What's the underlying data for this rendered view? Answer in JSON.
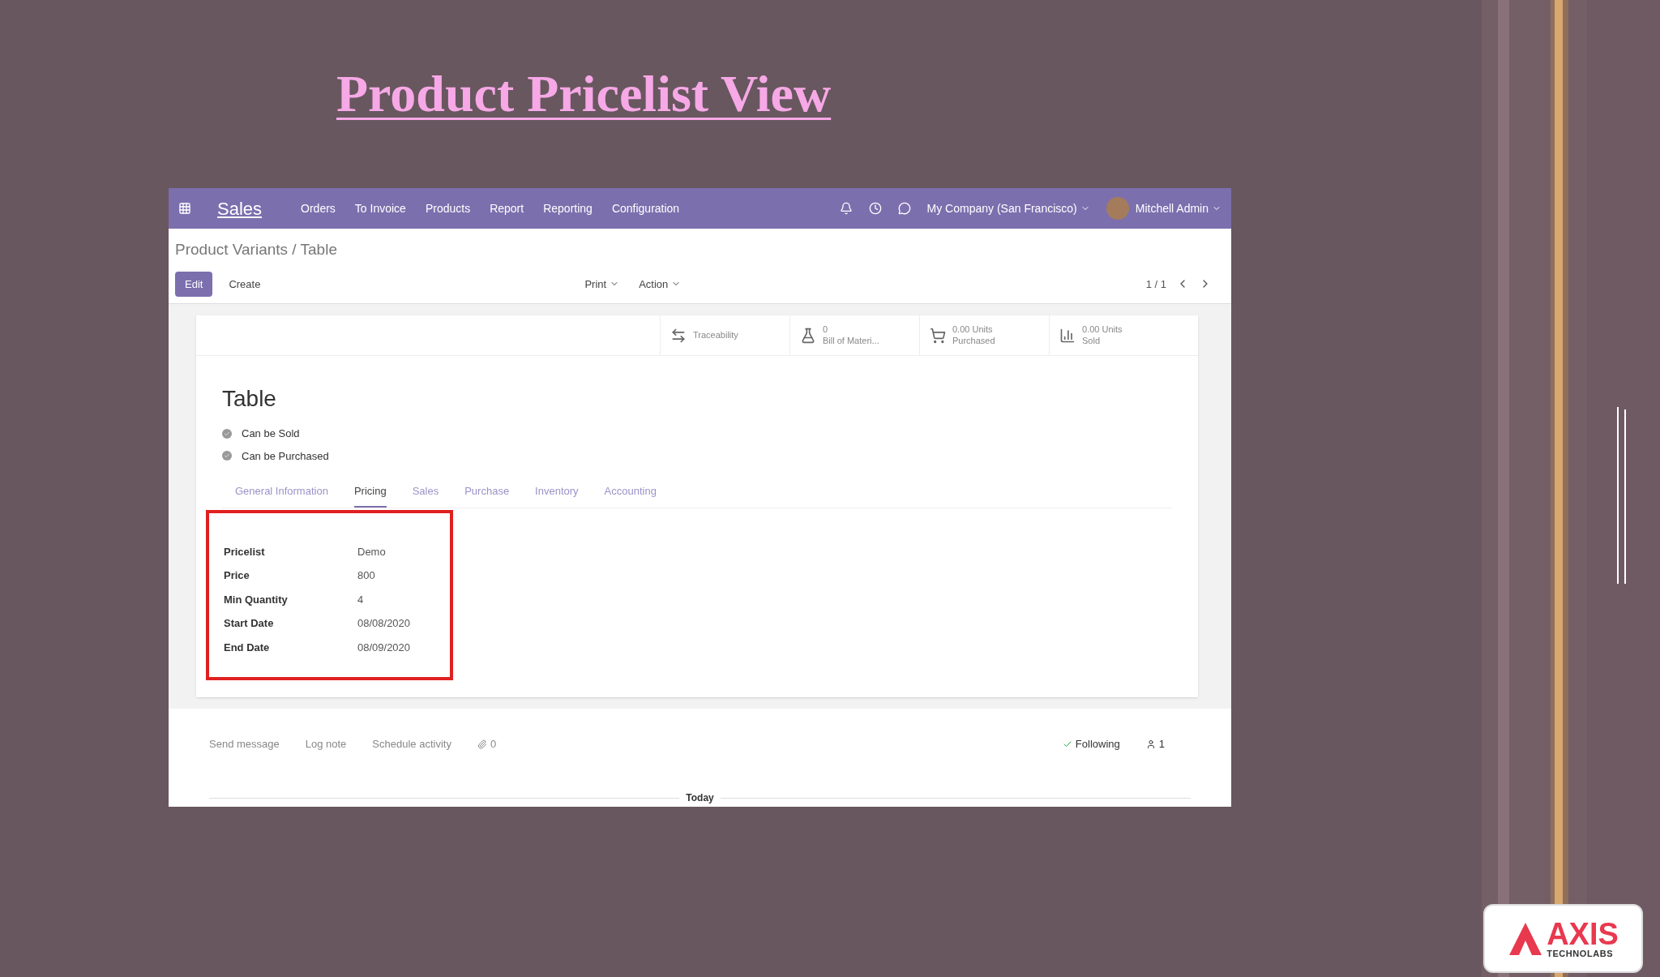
{
  "slide_title": "Product Pricelist View",
  "app": {
    "navbar": {
      "app_name": "Sales",
      "menu": [
        "Orders",
        "To Invoice",
        "Products",
        "Report",
        "Reporting",
        "Configuration"
      ],
      "company": "My Company (San Francisco)",
      "user": "Mitchell Admin"
    },
    "breadcrumb": "Product Variants / Table",
    "buttons": [
      {
        "label": "Edit",
        "kind": "primary"
      },
      {
        "label": "Create",
        "kind": "secondary"
      }
    ],
    "dropdowns": [
      "Print",
      "Action"
    ],
    "pager": "1 / 1",
    "smart_buttons": [
      {
        "kind": "traceability",
        "label": "Traceability"
      },
      {
        "kind": "bom",
        "value": "0",
        "label": "Bill of Materi..."
      },
      {
        "kind": "purchased",
        "value": "0.00 Units",
        "label": "Purchased"
      },
      {
        "kind": "sold",
        "value": "0.00 Units",
        "label": "Sold"
      }
    ],
    "record_title": "Table",
    "options": [
      {
        "label": "Can be Sold",
        "checked": true
      },
      {
        "label": "Can be Purchased",
        "checked": true
      }
    ],
    "tabs": [
      {
        "label": "General Information",
        "selected": false
      },
      {
        "label": "Pricing",
        "selected": true
      },
      {
        "label": "Sales",
        "selected": false
      },
      {
        "label": "Purchase",
        "selected": false
      },
      {
        "label": "Inventory",
        "selected": false
      },
      {
        "label": "Accounting",
        "selected": false
      }
    ],
    "fields": [
      {
        "label": "Pricelist",
        "value": "Demo"
      },
      {
        "label": "Price",
        "value": "800"
      },
      {
        "label": "Min Quantity",
        "value": "4"
      },
      {
        "label": "Start Date",
        "value": "08/08/2020"
      },
      {
        "label": "End Date",
        "value": "08/09/2020"
      }
    ],
    "chatter": {
      "actions": [
        "Send message",
        "Log note",
        "Schedule activity"
      ],
      "attachments": "0",
      "follow": "Following",
      "followers": "1",
      "date_separator": "Today"
    }
  },
  "logo": {
    "name": "AXIS",
    "tagline": "TECHNOLABS"
  }
}
